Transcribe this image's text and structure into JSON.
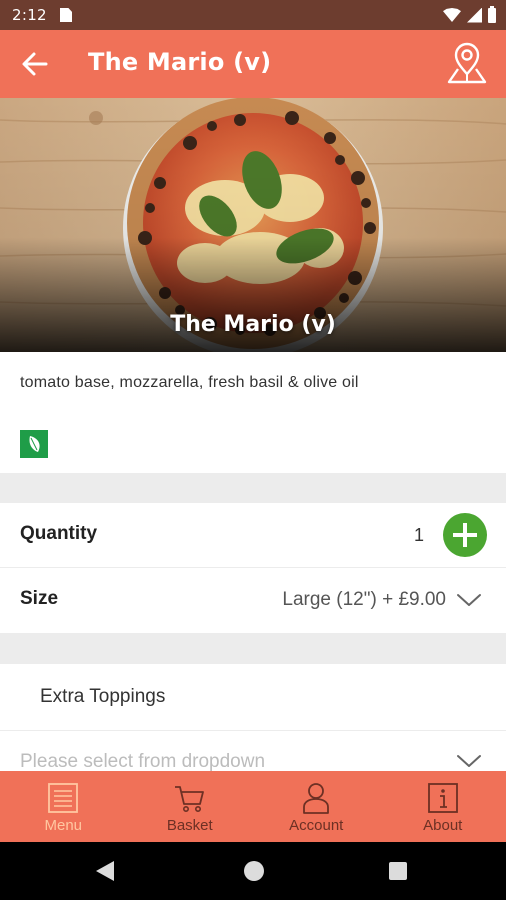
{
  "status_bar": {
    "time": "2:12"
  },
  "header": {
    "title": "The Mario (v)"
  },
  "hero": {
    "caption": "The Mario (v)"
  },
  "product": {
    "description": "tomato base, mozzarella, fresh basil & olive oil",
    "diet_icon": "vegetarian-leaf-icon"
  },
  "quantity": {
    "label": "Quantity",
    "value": "1"
  },
  "size": {
    "label": "Size",
    "value": "Large (12\")  + £9.00"
  },
  "toppings": {
    "label": "Extra Toppings",
    "placeholder": "Please select from dropdown"
  },
  "bottom_nav": {
    "items": [
      {
        "label": "Menu",
        "icon": "menu-book-icon",
        "active": true
      },
      {
        "label": "Basket",
        "icon": "cart-icon",
        "active": false
      },
      {
        "label": "Account",
        "icon": "person-icon",
        "active": false
      },
      {
        "label": "About",
        "icon": "info-icon",
        "active": false
      }
    ]
  },
  "colors": {
    "brand": "#f07158",
    "status_bar": "#6d3d2f",
    "add_button": "#4ba631",
    "veg_badge": "#1f9d48",
    "nav_active": "#ffc7a1",
    "nav_inactive": "#6d3024"
  }
}
